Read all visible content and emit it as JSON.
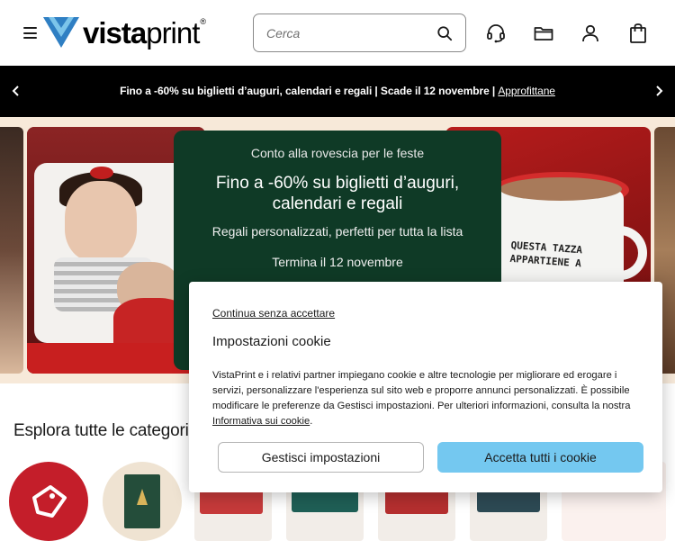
{
  "header": {
    "menu_icon": "hamburger-menu-icon",
    "logo_text_bold": "vista",
    "logo_text_regular": "print",
    "logo_reg": "®",
    "search": {
      "placeholder": "Cerca",
      "value": ""
    },
    "icons": [
      "search-icon",
      "headset-help-icon",
      "folder-icon",
      "user-icon",
      "cart-icon"
    ],
    "colors": {
      "logo_blue": "#2f7fc3",
      "logo_light": "#7cc4ea"
    }
  },
  "promo_bar": {
    "text": "Fino a -60% su biglietti d’auguri, calendari e regali | Scade il 12 novembre | ",
    "link": "Approfittane",
    "background": "#000000"
  },
  "hero": {
    "kicker": "Conto alla rovescia per le feste",
    "title": "Fino a -60% su biglietti d’auguri, calendari e regali",
    "subtitle": "Regali personalizzati, perfetti per tutta la lista",
    "date": "Termina il 12 novembre",
    "mug_text": [
      "QUESTA TAZZA",
      "APPARTIENE A"
    ],
    "card_color": "#0f3a26"
  },
  "categories": {
    "title": "Esplora tutte le categorie"
  },
  "cookie_dialog": {
    "skip_link": "Continua senza accettare",
    "title": "Impostazioni cookie",
    "body": "VistaPrint e i relativi partner impiegano cookie e altre tecnologie per migliorare ed erogare i servizi, personalizzare l'esperienza sul sito web e proporre annunci personalizzati. È possibile modificare le preferenze da Gestisci impostazioni. Per ulteriori informazioni, consulta la nostra ",
    "policy_link": "Informativa sui cookie",
    "body_end": ".",
    "manage_button": "Gestisci impostazioni",
    "accept_button": "Accetta tutti i cookie",
    "accept_color": "#74c8f0"
  }
}
